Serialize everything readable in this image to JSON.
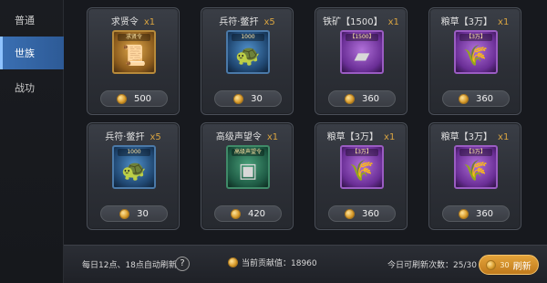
{
  "sidebar": {
    "tabs": [
      {
        "label": "普通",
        "active": false
      },
      {
        "label": "世族",
        "active": true
      },
      {
        "label": "战功",
        "active": false
      }
    ]
  },
  "items": [
    {
      "name": "求贤令",
      "qty": "x1",
      "tag": "求贤令",
      "price": "500",
      "rarity": "gold",
      "icon": "scroll-icon"
    },
    {
      "name": "兵符·鳖扞",
      "qty": "x5",
      "tag": "1000",
      "price": "30",
      "rarity": "blue",
      "icon": "beast-token-icon"
    },
    {
      "name": "铁矿【1500】",
      "qty": "x1",
      "tag": "【1500】",
      "price": "360",
      "rarity": "purple",
      "icon": "iron-ore-icon"
    },
    {
      "name": "粮草【3万】",
      "qty": "x1",
      "tag": "【3万】",
      "price": "360",
      "rarity": "purple",
      "icon": "grain-icon"
    },
    {
      "name": "兵符·鳖扞",
      "qty": "x5",
      "tag": "1000",
      "price": "30",
      "rarity": "blue",
      "icon": "beast-token-icon"
    },
    {
      "name": "高级声望令",
      "qty": "x1",
      "tag": "高级声望令",
      "price": "420",
      "rarity": "green",
      "icon": "jade-token-icon"
    },
    {
      "name": "粮草【3万】",
      "qty": "x1",
      "tag": "【3万】",
      "price": "360",
      "rarity": "purple",
      "icon": "grain-icon"
    },
    {
      "name": "粮草【3万】",
      "qty": "x1",
      "tag": "【3万】",
      "price": "360",
      "rarity": "purple",
      "icon": "grain-icon"
    }
  ],
  "footer": {
    "refresh_schedule": "每日12点、18点自动刷新",
    "contribution": "当前贡献值：18960",
    "remaining_refreshes": "今日可刷新次数：25/30",
    "refresh_cost": "30",
    "refresh_label": "刷新"
  }
}
